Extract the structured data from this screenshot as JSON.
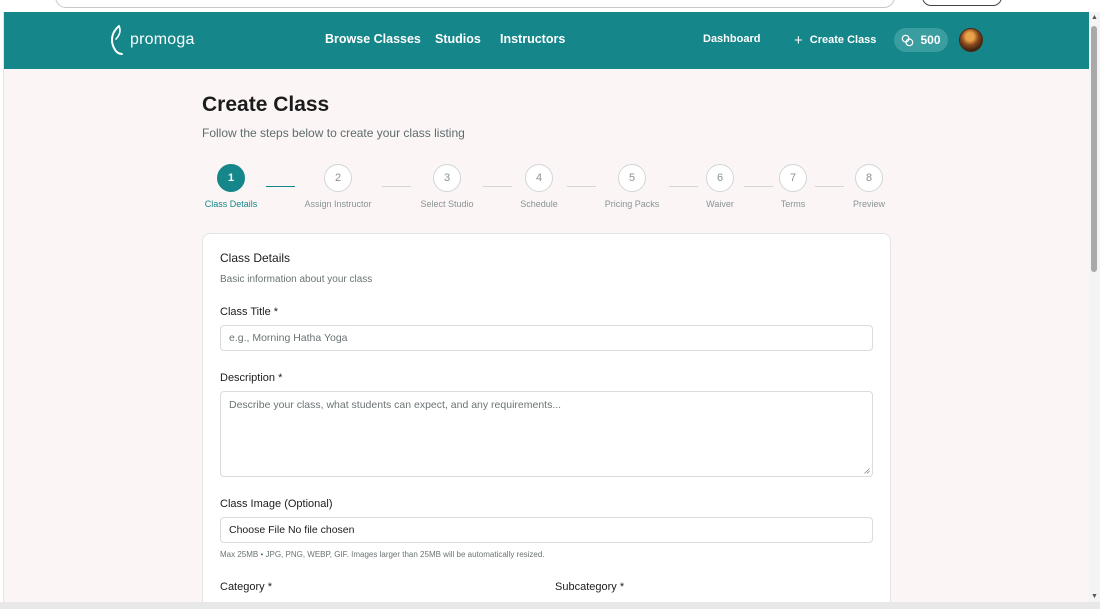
{
  "navbar": {
    "logo_text": "promoga",
    "links": [
      "Browse Classes",
      "Studios",
      "Instructors"
    ],
    "dashboard_label": "Dashboard",
    "create_class_label": "Create Class",
    "credits": "500",
    "brand_color": "#15868a"
  },
  "page": {
    "title": "Create Class",
    "subtitle": "Follow the steps below to create your class listing"
  },
  "stepper": {
    "active_step": 1,
    "steps": [
      {
        "number": "1",
        "label": "Class Details"
      },
      {
        "number": "2",
        "label": "Assign Instructor"
      },
      {
        "number": "3",
        "label": "Select Studio"
      },
      {
        "number": "4",
        "label": "Schedule"
      },
      {
        "number": "5",
        "label": "Pricing Packs"
      },
      {
        "number": "6",
        "label": "Waiver"
      },
      {
        "number": "7",
        "label": "Terms"
      },
      {
        "number": "8",
        "label": "Preview"
      }
    ]
  },
  "form": {
    "card_title": "Class Details",
    "card_description": "Basic information about your class",
    "class_title_label": "Class Title *",
    "class_title_placeholder": "e.g., Morning Hatha Yoga",
    "description_label": "Description *",
    "description_placeholder": "Describe your class, what students can expect, and any requirements...",
    "image_label": "Class Image (Optional)",
    "file_input_text": "Choose File No file chosen",
    "image_hint": "Max 25MB • JPG, PNG, WEBP, GIF. Images larger than 25MB will be automatically resized.",
    "category_label": "Category *",
    "subcategory_label": "Subcategory *"
  },
  "icons": {
    "logo": "promoga-leaf-icon",
    "plus": "plus-icon",
    "credits": "coins-icon",
    "resize": "resize-grip-icon"
  }
}
